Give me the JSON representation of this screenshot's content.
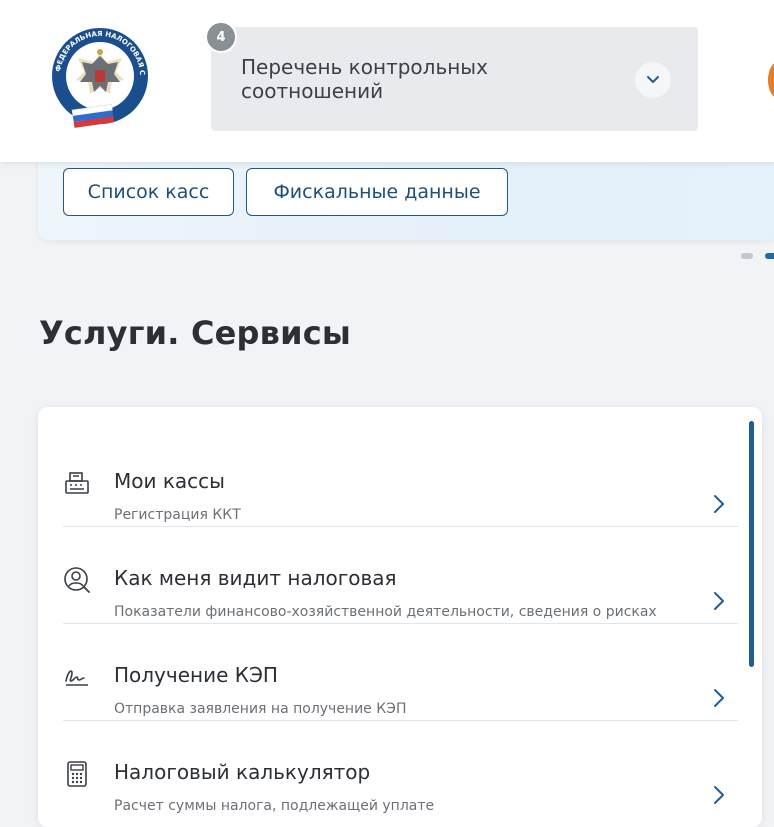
{
  "header": {
    "logo_text": "ФЕДЕРАЛЬНАЯ НАЛОГОВАЯ СЛУЖБА",
    "dropdown": {
      "badge": "4",
      "label": "Перечень контрольных соотношений"
    }
  },
  "top_card": {
    "chips": [
      {
        "label": "Список касс"
      },
      {
        "label": "Фискальные данные"
      }
    ]
  },
  "services": {
    "title": "Услуги. Сервисы",
    "items": [
      {
        "title": "Мои кассы",
        "subtitle": "Регистрация ККТ",
        "icon": "cash-register-icon"
      },
      {
        "title": "Как меня видит налоговая",
        "subtitle": "Показатели финансово-хозяйственной деятельности, сведения о рисках",
        "icon": "user-search-icon"
      },
      {
        "title": "Получение КЭП",
        "subtitle": "Отправка заявления на получение КЭП",
        "icon": "signature-icon"
      },
      {
        "title": "Налоговый калькулятор",
        "subtitle": "Расчет суммы налога, подлежащей уплате",
        "icon": "calculator-icon"
      }
    ]
  },
  "colors": {
    "accent": "#1e5e96",
    "chip_border": "#205a86",
    "background": "#f1f3f6"
  }
}
